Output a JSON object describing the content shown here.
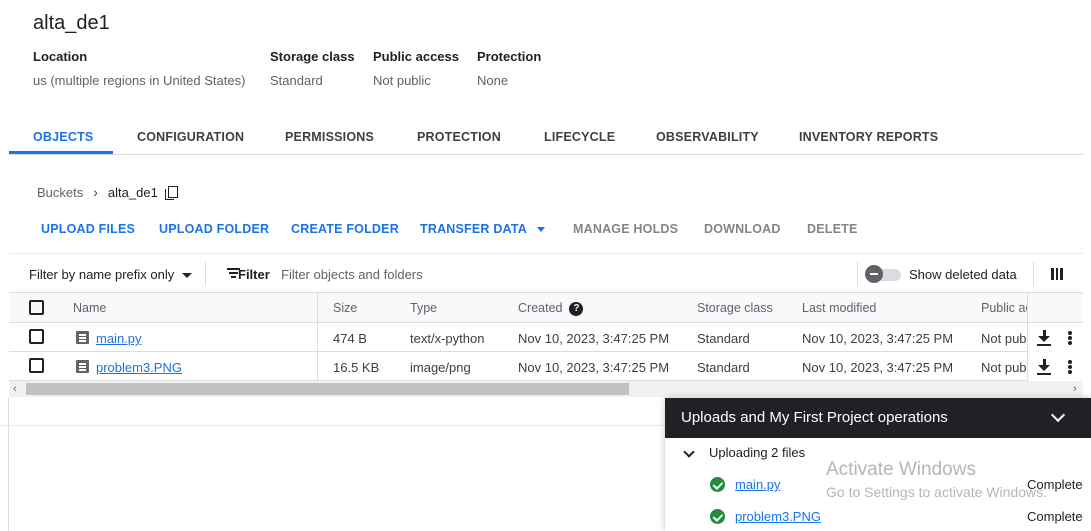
{
  "bucket": {
    "name": "alta_de1",
    "meta": [
      {
        "label": "Location",
        "value": "us (multiple regions in United States)"
      },
      {
        "label": "Storage class",
        "value": "Standard"
      },
      {
        "label": "Public access",
        "value": "Not public"
      },
      {
        "label": "Protection",
        "value": "None"
      }
    ]
  },
  "tabs": [
    "OBJECTS",
    "CONFIGURATION",
    "PERMISSIONS",
    "PROTECTION",
    "LIFECYCLE",
    "OBSERVABILITY",
    "INVENTORY REPORTS"
  ],
  "active_tab": "OBJECTS",
  "breadcrumb": {
    "root": "Buckets",
    "current": "alta_de1"
  },
  "actions": {
    "upload_files": "UPLOAD FILES",
    "upload_folder": "UPLOAD FOLDER",
    "create_folder": "CREATE FOLDER",
    "transfer_data": "TRANSFER DATA",
    "manage_holds": "MANAGE HOLDS",
    "download": "DOWNLOAD",
    "delete": "DELETE"
  },
  "filter": {
    "prefix_label": "Filter by name prefix only",
    "filter_label": "Filter",
    "placeholder": "Filter objects and folders",
    "show_deleted": "Show deleted data",
    "show_deleted_on": false
  },
  "table": {
    "headers": {
      "name": "Name",
      "size": "Size",
      "type": "Type",
      "created": "Created",
      "storage_class": "Storage class",
      "last_modified": "Last modified",
      "public": "Public ac"
    },
    "rows": [
      {
        "name": "main.py",
        "size": "474 B",
        "type": "text/x-python",
        "created": "Nov 10, 2023, 3:47:25 PM",
        "storage_class": "Standard",
        "last_modified": "Nov 10, 2023, 3:47:25 PM",
        "public": "Not pub"
      },
      {
        "name": "problem3.PNG",
        "size": "16.5 KB",
        "type": "image/png",
        "created": "Nov 10, 2023, 3:47:25 PM",
        "storage_class": "Standard",
        "last_modified": "Nov 10, 2023, 3:47:25 PM",
        "public": "Not pub"
      }
    ]
  },
  "uploads_panel": {
    "title": "Uploads and My First Project operations",
    "group_label": "Uploading 2 files",
    "items": [
      {
        "name": "main.py",
        "status": "Complete"
      },
      {
        "name": "problem3.PNG",
        "status": "Complete"
      }
    ]
  },
  "watermark": {
    "line1": "Activate Windows",
    "line2": "Go to Settings to activate Windows."
  },
  "colors": {
    "accent": "#1a73e8",
    "success": "#1e8e3e",
    "panel_header": "#202124"
  }
}
